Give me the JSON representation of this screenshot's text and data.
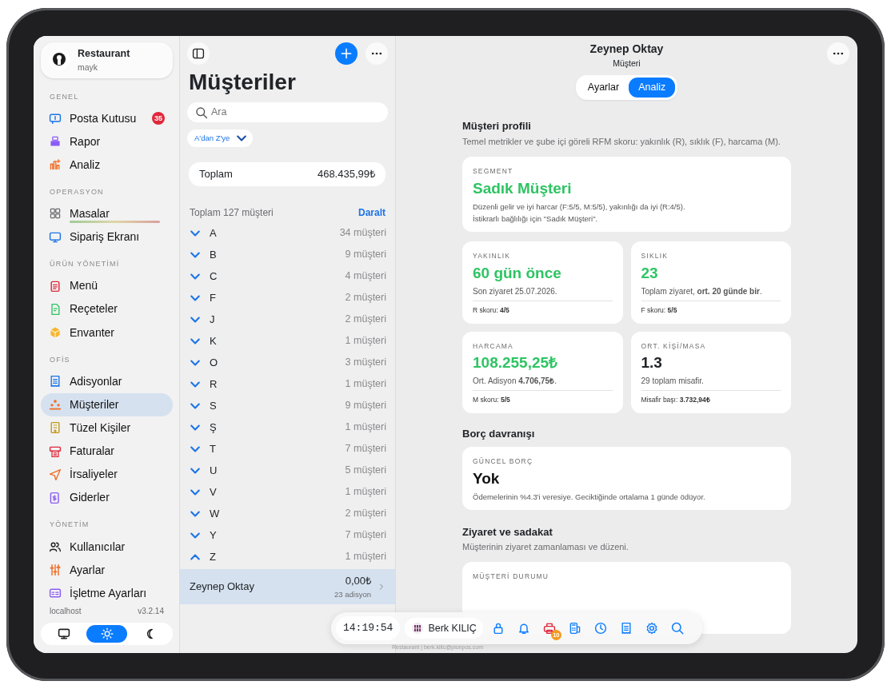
{
  "sidebar": {
    "account": {
      "title": "Restaurant",
      "subtitle": "mayk"
    },
    "sections": [
      {
        "title": "GENEL",
        "items": [
          {
            "label": "Posta Kutusu",
            "badge": "35",
            "selected": false
          },
          {
            "label": "Rapor",
            "selected": false
          },
          {
            "label": "Analiz",
            "selected": false
          }
        ]
      },
      {
        "title": "OPERASYON",
        "items": [
          {
            "label": "Masalar",
            "selected": false
          },
          {
            "label": "Sipariş Ekranı",
            "selected": false
          }
        ]
      },
      {
        "title": "ÜRÜN YÖNETİMİ",
        "items": [
          {
            "label": "Menü",
            "selected": false
          },
          {
            "label": "Reçeteler",
            "selected": false
          },
          {
            "label": "Envanter",
            "selected": false
          }
        ]
      },
      {
        "title": "OFİS",
        "items": [
          {
            "label": "Adisyonlar",
            "selected": false
          },
          {
            "label": "Müşteriler",
            "selected": true
          },
          {
            "label": "Tüzel Kişiler",
            "selected": false
          },
          {
            "label": "Faturalar",
            "selected": false
          },
          {
            "label": "İrsaliyeler",
            "selected": false
          },
          {
            "label": "Giderler",
            "selected": false
          }
        ]
      },
      {
        "title": "YÖNETİM",
        "items": [
          {
            "label": "Kullanıcılar",
            "selected": false
          },
          {
            "label": "Ayarlar",
            "selected": false
          },
          {
            "label": "İşletme Ayarları",
            "selected": false
          }
        ]
      }
    ],
    "host": "localhost",
    "version": "v3.2.14",
    "theme": [
      {
        "kind": "system",
        "selected": false
      },
      {
        "kind": "light",
        "selected": true
      },
      {
        "kind": "dark",
        "selected": false
      }
    ]
  },
  "list": {
    "title": "Müşteriler",
    "search": {
      "placeholder": "Ara"
    },
    "sort": "A'dan Z'ye",
    "total_label": "Toplam",
    "total_value": "468.435,99₺",
    "count": "Toplam 127 müşteri",
    "collapse": "Daralt",
    "groups": [
      {
        "letter": "A",
        "count": "34 müşteri",
        "expanded": false
      },
      {
        "letter": "B",
        "count": "9 müşteri",
        "expanded": false
      },
      {
        "letter": "C",
        "count": "4 müşteri",
        "expanded": false
      },
      {
        "letter": "F",
        "count": "2 müşteri",
        "expanded": false
      },
      {
        "letter": "J",
        "count": "2 müşteri",
        "expanded": false
      },
      {
        "letter": "K",
        "count": "1 müşteri",
        "expanded": false
      },
      {
        "letter": "O",
        "count": "3 müşteri",
        "expanded": false
      },
      {
        "letter": "R",
        "count": "1 müşteri",
        "expanded": false
      },
      {
        "letter": "S",
        "count": "9 müşteri",
        "expanded": false
      },
      {
        "letter": "Ş",
        "count": "1 müşteri",
        "expanded": false
      },
      {
        "letter": "T",
        "count": "7 müşteri",
        "expanded": false
      },
      {
        "letter": "U",
        "count": "5 müşteri",
        "expanded": false
      },
      {
        "letter": "V",
        "count": "1 müşteri",
        "expanded": false
      },
      {
        "letter": "W",
        "count": "2 müşteri",
        "expanded": false
      },
      {
        "letter": "Y",
        "count": "7 müşteri",
        "expanded": false
      },
      {
        "letter": "Z",
        "count": "1 müşteri",
        "expanded": true,
        "children": [
          {
            "name": "Zeynep Oktay",
            "amount": "0,00₺",
            "note": "23 adisyon",
            "selected": true
          }
        ]
      }
    ]
  },
  "detail": {
    "title": "Zeynep Oktay",
    "subtitle": "Müşteri",
    "tabs": [
      {
        "label": "Ayarlar",
        "selected": false
      },
      {
        "label": "Analiz",
        "selected": true
      }
    ],
    "profile": {
      "title": "Müşteri profili",
      "description": "Temel metrikler ve şube içi göreli RFM skoru: yakınlık (R), sıklık (F), harcama (M).",
      "segment": {
        "label": "SEGMENT",
        "value": "Sadık Müşteri",
        "lines": [
          "Düzenli gelir ve iyi harcar (F:5/5, M:5/5), yakınlığı da iyi (R:4/5).",
          "İstikrarlı bağlılığı için \"Sadık Müşteri\"."
        ]
      },
      "metrics": [
        {
          "label": "YAKINLIK",
          "value": "60 gün önce",
          "kind": "positive",
          "note": "Son ziyaret 25.07.2026.",
          "score": "R skoru: **4/5**"
        },
        {
          "label": "SIKLIK",
          "value": "23",
          "kind": "positive",
          "note": "Toplam ziyaret, **ort. 20 günde bir**.",
          "score": "F skoru: **5/5**"
        },
        {
          "label": "HARCAMA",
          "value": "108.255,25₺",
          "kind": "positive",
          "note": "Ort. Adisyon **4.706,75₺**.",
          "score": "M skoru: **5/5**"
        },
        {
          "label": "ORT. KİŞİ/MASA",
          "value": "1.3",
          "kind": "neutral",
          "note": "29 toplam misafir.",
          "score": "Misafir başı: **3.732,94₺**"
        }
      ]
    },
    "debt": {
      "title": "Borç davranışı",
      "label": "GÜNCEL BORÇ",
      "value": "Yok",
      "note": "Ödemelerinin %4.3'i veresiye. Geciktiğinde ortalama 1 günde ödüyor."
    },
    "visits": {
      "title": "Ziyaret ve sadakat",
      "description": "Müşterinin ziyaret zamanlaması ve düzeni.",
      "label": "MÜŞTERİ DURUMU"
    }
  },
  "toolbar": {
    "time": "14:19:54",
    "user": "Berk KILIÇ",
    "printer_badge": "10",
    "footer": "Restaurant | berk.kilic@pionpos.com"
  }
}
